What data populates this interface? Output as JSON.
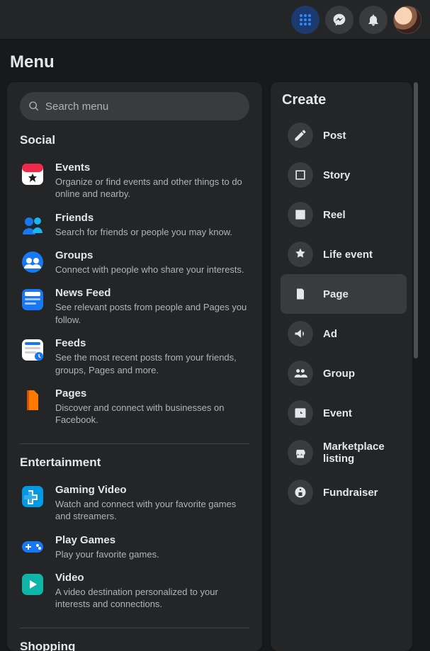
{
  "header": {
    "title": "Menu"
  },
  "search": {
    "placeholder": "Search menu"
  },
  "sections": [
    {
      "title": "Social",
      "items": [
        {
          "title": "Events",
          "desc": "Organize or find events and other things to do online and nearby.",
          "icon": "events"
        },
        {
          "title": "Friends",
          "desc": "Search for friends or people you may know.",
          "icon": "friends"
        },
        {
          "title": "Groups",
          "desc": "Connect with people who share your interests.",
          "icon": "groups"
        },
        {
          "title": "News Feed",
          "desc": "See relevant posts from people and Pages you follow.",
          "icon": "newsfeed"
        },
        {
          "title": "Feeds",
          "desc": "See the most recent posts from your friends, groups, Pages and more.",
          "icon": "feeds"
        },
        {
          "title": "Pages",
          "desc": "Discover and connect with businesses on Facebook.",
          "icon": "pages"
        }
      ]
    },
    {
      "title": "Entertainment",
      "items": [
        {
          "title": "Gaming Video",
          "desc": "Watch and connect with your favorite games and streamers.",
          "icon": "gaming"
        },
        {
          "title": "Play Games",
          "desc": "Play your favorite games.",
          "icon": "play"
        },
        {
          "title": "Video",
          "desc": "A video destination personalized to your interests and connections.",
          "icon": "video"
        }
      ]
    },
    {
      "title": "Shopping",
      "items": []
    }
  ],
  "create": {
    "title": "Create",
    "items": [
      {
        "label": "Post",
        "icon": "post",
        "selected": false
      },
      {
        "label": "Story",
        "icon": "story",
        "selected": false
      },
      {
        "label": "Reel",
        "icon": "reel",
        "selected": false
      },
      {
        "label": "Life event",
        "icon": "life",
        "selected": false
      },
      {
        "label": "Page",
        "icon": "page",
        "selected": true
      },
      {
        "label": "Ad",
        "icon": "ad",
        "selected": false
      },
      {
        "label": "Group",
        "icon": "group",
        "selected": false
      },
      {
        "label": "Event",
        "icon": "event",
        "selected": false
      },
      {
        "label": "Marketplace listing",
        "icon": "market",
        "selected": false
      },
      {
        "label": "Fundraiser",
        "icon": "fund",
        "selected": false
      }
    ]
  }
}
